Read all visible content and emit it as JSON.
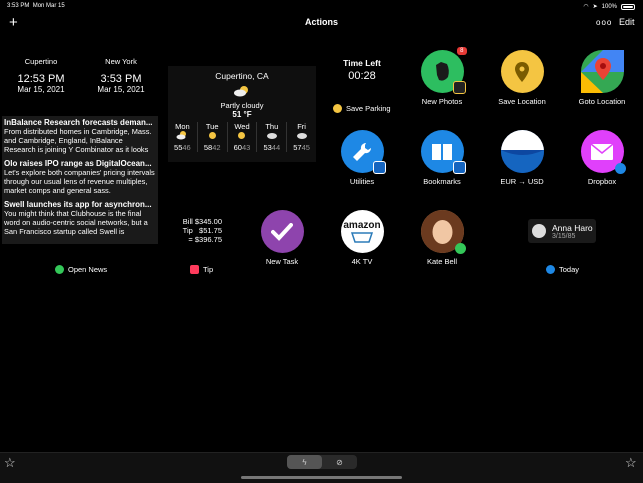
{
  "status": {
    "time": "3:53 PM",
    "date": "Mon Mar 15",
    "battery": "100%"
  },
  "navbar": {
    "title": "Actions",
    "plus": "+",
    "more": "ooo",
    "edit": "Edit"
  },
  "clocks": [
    {
      "city": "Cupertino",
      "time": "12:53 PM",
      "date": "Mar 15, 2021"
    },
    {
      "city": "New York",
      "time": "3:53 PM",
      "date": "Mar 15, 2021"
    }
  ],
  "news": [
    {
      "title": "InBalance Research forecasts deman...",
      "body": "From distributed homes in Cambridge, Mass. and Cambridge, England, InBalance Research is joining Y Combinator as it looks"
    },
    {
      "title": "Olo raises IPO range as DigitalOcean...",
      "body": "Let's explore both companies' pricing intervals through our usual lens of revenue multiples, market comps and general sass."
    },
    {
      "title": "Swell launches its app for asynchron...",
      "body": "You might think that Clubhouse is the final word on audio-centric social networks, but a San Francisco startup called Swell is"
    }
  ],
  "open_news": "Open News",
  "weather": {
    "location": "Cupertino, CA",
    "condition": "Partly cloudy",
    "temp": "51 °F",
    "days": [
      {
        "day": "Mon",
        "hi": "55",
        "lo": "46"
      },
      {
        "day": "Tue",
        "hi": "58",
        "lo": "42"
      },
      {
        "day": "Wed",
        "hi": "60",
        "lo": "43"
      },
      {
        "day": "Thu",
        "hi": "53",
        "lo": "44"
      },
      {
        "day": "Fri",
        "hi": "57",
        "lo": "45"
      }
    ]
  },
  "timer": {
    "label": "Time Left",
    "value": "00:28",
    "action": "Save Parking"
  },
  "tip": {
    "bill": "Bill $345.00",
    "tip": "Tip   $51.75",
    "total": "= $396.75",
    "label": "Tip"
  },
  "apps": {
    "new_photos": {
      "label": "New Photos",
      "badge": "8"
    },
    "save_location": "Save Location",
    "goto_location": "Goto Location",
    "utilities": "Utilities",
    "bookmarks": "Bookmarks",
    "eur_usd": "EUR → USD",
    "dropbox": "Dropbox",
    "new_task": "New Task",
    "tv": "4K TV",
    "kate": "Kate Bell",
    "amazon_text": "amazon"
  },
  "contact": {
    "name": "Anna Haro",
    "date": "3/15/85"
  },
  "today": "Today",
  "colors": {
    "background": "#000000",
    "evernote": "#2dbe60",
    "location": "#f4c542",
    "utilities": "#1e88e5",
    "dropbox": "#e040fb",
    "task": "#8e44ad"
  }
}
